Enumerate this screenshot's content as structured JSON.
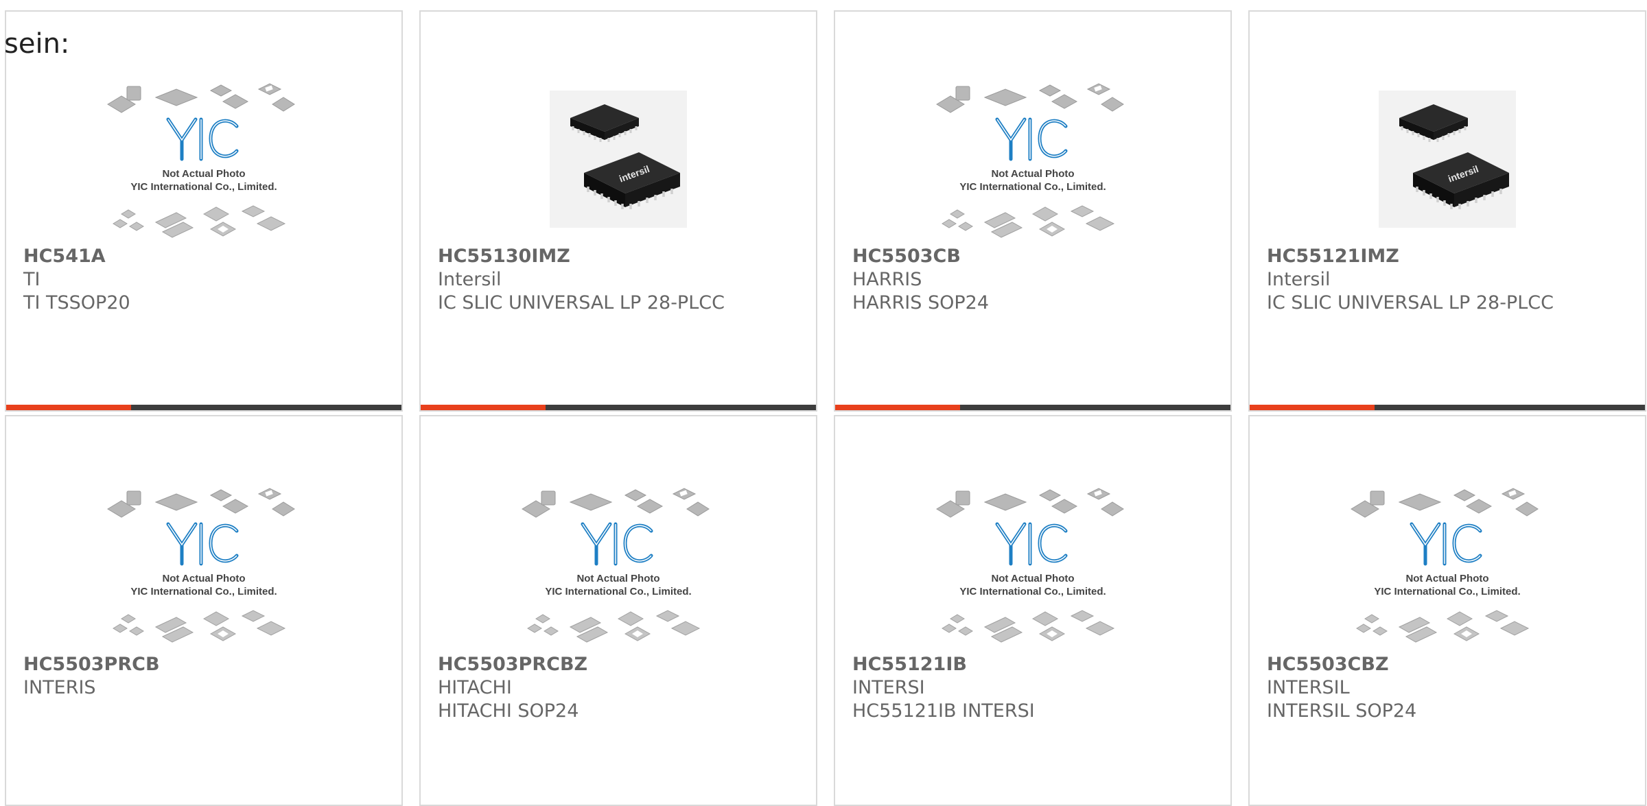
{
  "intro_text": "sein:",
  "accent_color": "#e8401c",
  "bar_color": "#3d3d3d",
  "placeholder_image": {
    "logo": "YIC",
    "line1": "Not Actual Photo",
    "line2": "YIC International Co., Limited."
  },
  "chip_image": {
    "brand_mark": "intersil"
  },
  "products": [
    {
      "part": "HC541A",
      "brand": "TI",
      "desc": "TI TSSOP20",
      "image": "placeholder-photo"
    },
    {
      "part": "HC55130IMZ",
      "brand": "Intersil",
      "desc": "IC SLIC UNIVERSAL LP 28-PLCC",
      "image": "plcc-chip-photo"
    },
    {
      "part": "HC5503CB",
      "brand": "HARRIS",
      "desc": "HARRIS SOP24",
      "image": "placeholder-photo"
    },
    {
      "part": "HC55121IMZ",
      "brand": "Intersil",
      "desc": "IC SLIC UNIVERSAL LP 28-PLCC",
      "image": "plcc-chip-photo"
    },
    {
      "part": "HC5503PRCB",
      "brand": "INTERIS",
      "desc": "",
      "image": "placeholder-photo"
    },
    {
      "part": "HC5503PRCBZ",
      "brand": "HITACHI",
      "desc": "HITACHI SOP24",
      "image": "placeholder-photo"
    },
    {
      "part": "HC55121IB",
      "brand": "INTERSI",
      "desc": "HC55121IB INTERSI",
      "image": "placeholder-photo"
    },
    {
      "part": "HC5503CBZ",
      "brand": "INTERSIL",
      "desc": "INTERSIL SOP24",
      "image": "placeholder-photo"
    }
  ]
}
